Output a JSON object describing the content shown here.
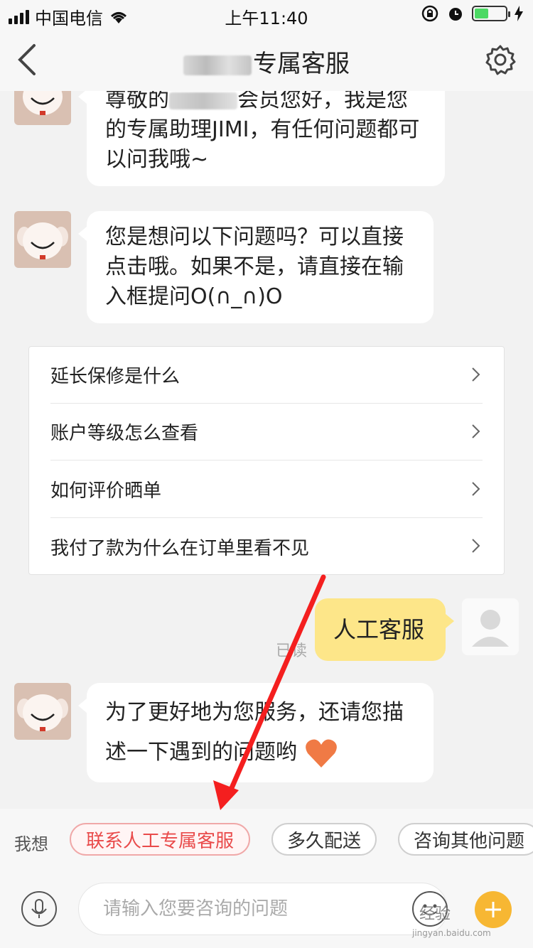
{
  "status_bar": {
    "carrier": "中国电信",
    "time": "上午11:40"
  },
  "nav": {
    "title": "专属客服"
  },
  "messages": [
    {
      "text_line1_prefix": "尊敬的",
      "text_line1_suffix": "会员您好，我是您",
      "text_rest": "的专属助理JIMI，有任何问题都可以问我哦~"
    },
    {
      "text": "您是想问以下问题吗？可以直接点击哦。如果不是，请直接在输入框提问O(∩_∩)O"
    }
  ],
  "questions": [
    "延长保修是什么",
    "账户等级怎么查看",
    "如何评价晒单",
    "我付了款为什么在订单里看不见"
  ],
  "user_message": {
    "text": "人工客服",
    "status": "已读"
  },
  "reply": {
    "text": "为了更好地为您服务，还请您描述一下遇到的问题哟"
  },
  "quick_replies": {
    "label": "我想",
    "items": [
      "联系人工专属客服",
      "多久配送",
      "咨询其他问题"
    ]
  },
  "input": {
    "placeholder": "请输入您要咨询的问题"
  },
  "watermark": {
    "text": "经验",
    "url": "jingyan.baidu.com"
  },
  "colors": {
    "accent_red": "#e94b4b",
    "user_bubble": "#fde689",
    "annotation_arrow": "#f41f1f"
  }
}
